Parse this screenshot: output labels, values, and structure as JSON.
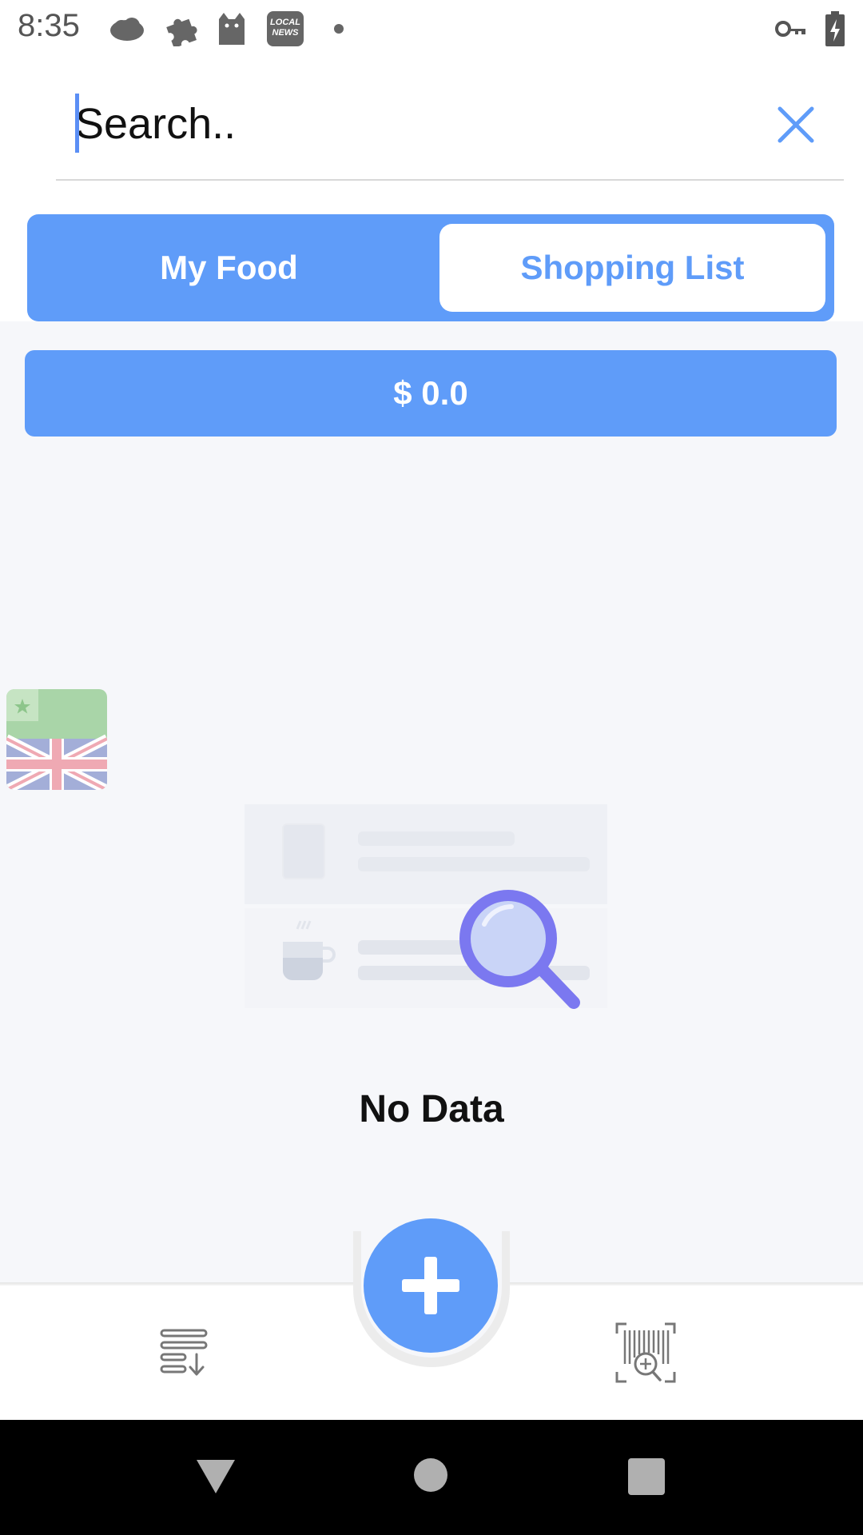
{
  "status_bar": {
    "time": "8:35",
    "icons": [
      "cloud-icon",
      "puzzle-icon",
      "cat-icon",
      "local-news-icon",
      "dot-icon",
      "vpn-key-icon",
      "battery-charging-icon"
    ],
    "news_icon_text": "LOCAL NEWS"
  },
  "search": {
    "placeholder": "Search..",
    "value": ""
  },
  "tabs": {
    "my_food": "My Food",
    "shopping_list": "Shopping List",
    "selected": "My Food"
  },
  "total": {
    "label": "$ 0.0"
  },
  "language_flag": "esperanto-english-flag-icon",
  "empty_state": {
    "message": "No Data",
    "illustration": "empty-search-illustration"
  },
  "bottom_nav": {
    "left_icon": "list-download-icon",
    "fab_icon": "plus-icon",
    "right_icon": "barcode-scan-icon"
  },
  "colors": {
    "accent": "#5f9cf9",
    "background": "#f6f7fa"
  }
}
